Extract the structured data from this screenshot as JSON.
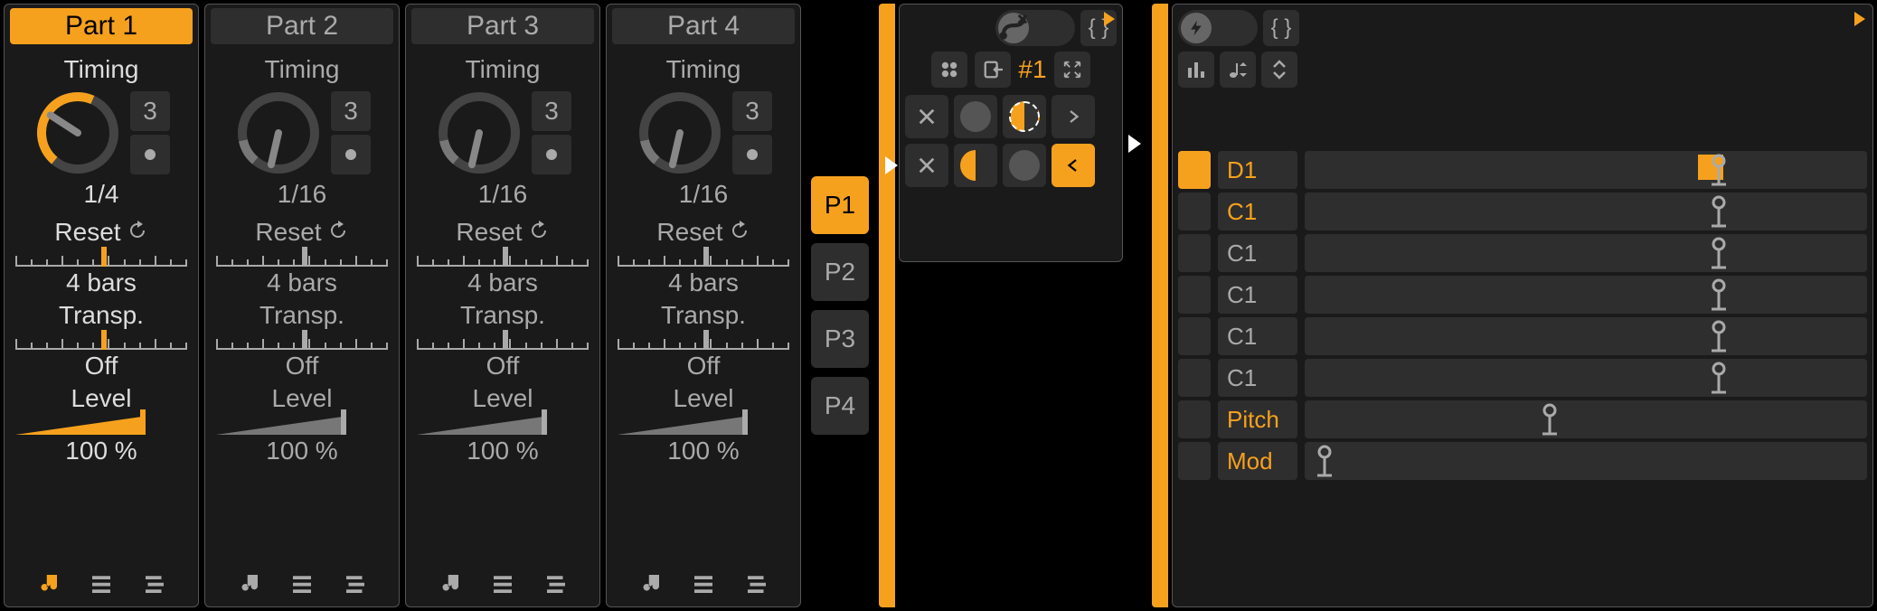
{
  "parts": [
    {
      "name": "Part 1",
      "active": true,
      "timing_label": "Timing",
      "timing_val": "1/4",
      "num": "3",
      "reset": "Reset",
      "bars": "4 bars",
      "transp": "Transp.",
      "transp_val": "Off",
      "level": "Level",
      "level_val": "100 %",
      "knob_percent": 0.65
    },
    {
      "name": "Part 2",
      "active": false,
      "timing_label": "Timing",
      "timing_val": "1/16",
      "num": "3",
      "reset": "Reset",
      "bars": "4 bars",
      "transp": "Transp.",
      "transp_val": "Off",
      "level": "Level",
      "level_val": "100 %",
      "knob_percent": 0.15
    },
    {
      "name": "Part 3",
      "active": false,
      "timing_label": "Timing",
      "timing_val": "1/16",
      "num": "3",
      "reset": "Reset",
      "bars": "4 bars",
      "transp": "Transp.",
      "transp_val": "Off",
      "level": "Level",
      "level_val": "100 %",
      "knob_percent": 0.15
    },
    {
      "name": "Part 4",
      "active": false,
      "timing_label": "Timing",
      "timing_val": "1/16",
      "num": "3",
      "reset": "Reset",
      "bars": "4 bars",
      "transp": "Transp.",
      "transp_val": "Off",
      "level": "Level",
      "level_val": "100 %",
      "knob_percent": 0.15
    }
  ],
  "ptabs": [
    "P1",
    "P2",
    "P3",
    "P4"
  ],
  "ptab_active": 0,
  "mid": {
    "hash": "#1"
  },
  "right": {
    "braces": "{ }",
    "lanes": [
      {
        "label": "D1",
        "active": true,
        "orange_txt": true,
        "marker_pos": 0.72,
        "has_note": true
      },
      {
        "label": "C1",
        "active": false,
        "orange_txt": true,
        "marker_pos": 0.72
      },
      {
        "label": "C1",
        "active": false,
        "orange_txt": false,
        "marker_pos": 0.72
      },
      {
        "label": "C1",
        "active": false,
        "orange_txt": false,
        "marker_pos": 0.72
      },
      {
        "label": "C1",
        "active": false,
        "orange_txt": false,
        "marker_pos": 0.72
      },
      {
        "label": "C1",
        "active": false,
        "orange_txt": false,
        "marker_pos": 0.72
      },
      {
        "label": "Pitch",
        "active": false,
        "orange_txt": true,
        "marker_pos": 0.42
      },
      {
        "label": "Mod",
        "active": false,
        "orange_txt": true,
        "marker_pos": 0.02
      }
    ]
  }
}
